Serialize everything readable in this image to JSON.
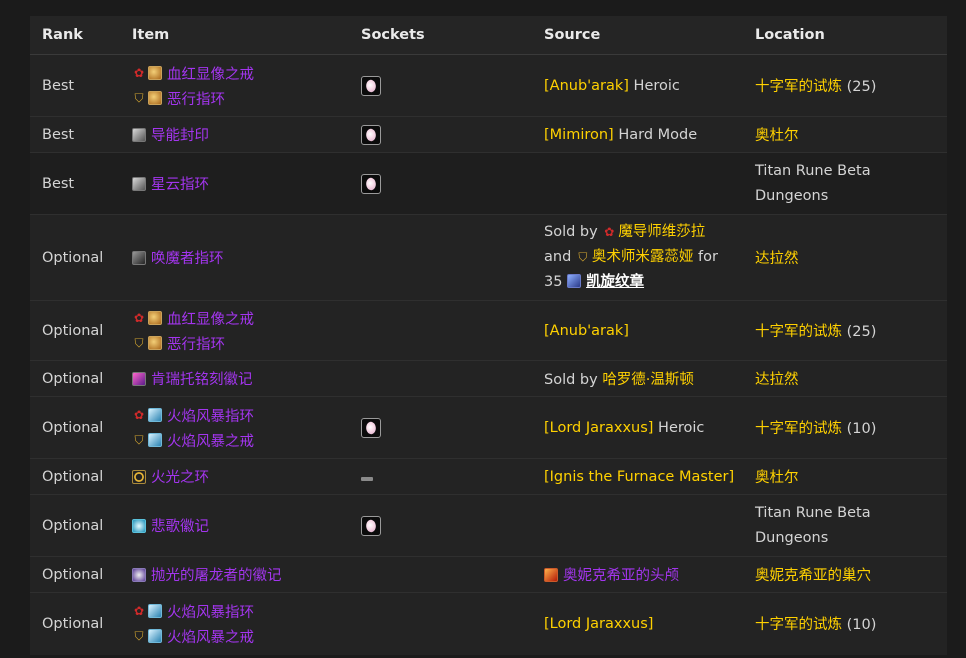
{
  "headers": [
    "Rank",
    "Item",
    "Sockets",
    "Source",
    "Location"
  ],
  "rows": [
    {
      "rank": "Best",
      "items": [
        {
          "faction": "horde",
          "icon": "gold-face",
          "name": "血红显像之戒"
        },
        {
          "faction": "alliance",
          "icon": "gold-face",
          "name": "恶行指环"
        }
      ],
      "socket": "gem",
      "source": {
        "bracket": "[Anub'arak]",
        "suffix": " Heroic"
      },
      "location": {
        "name": "十字军的试炼",
        "suffix": " (25)"
      }
    },
    {
      "rank": "Best",
      "items": [
        {
          "faction": "",
          "icon": "gray",
          "name": "导能封印"
        }
      ],
      "socket": "gem",
      "source": {
        "bracket": "[Mimiron]",
        "suffix": " Hard Mode"
      },
      "location": {
        "name": "奥杜尔",
        "suffix": ""
      }
    },
    {
      "rank": "Best",
      "items": [
        {
          "faction": "",
          "icon": "gray",
          "name": "星云指环"
        }
      ],
      "socket": "gem",
      "source": {
        "bracket": "",
        "suffix": ""
      },
      "location": {
        "name": "",
        "suffix": "",
        "plain_lines": [
          "Titan Rune Beta",
          "Dungeons"
        ]
      }
    },
    {
      "rank": "Optional",
      "items": [
        {
          "faction": "",
          "icon": "dark",
          "name": "唤魔者指环"
        }
      ],
      "socket": "",
      "source": {
        "sold_by": "Sold by",
        "vendor_horde": "魔导师维莎拉",
        "and": "and",
        "vendor_alliance": "奥术师米露蕊娅",
        "for": "for",
        "price": "35",
        "currency": "凯旋纹章"
      },
      "location": {
        "name": "达拉然",
        "suffix": ""
      }
    },
    {
      "rank": "Optional",
      "items": [
        {
          "faction": "horde",
          "icon": "gold-face",
          "name": "血红显像之戒"
        },
        {
          "faction": "alliance",
          "icon": "gold-face",
          "name": "恶行指环"
        }
      ],
      "socket": "",
      "source": {
        "bracket": "[Anub'arak]",
        "suffix": ""
      },
      "location": {
        "name": "十字军的试炼",
        "suffix": " (25)"
      }
    },
    {
      "rank": "Optional",
      "items": [
        {
          "faction": "",
          "icon": "purple",
          "name": "肯瑞托铭刻徽记"
        }
      ],
      "socket": "",
      "source": {
        "sold_by": "Sold by",
        "vendor": "哈罗德·温斯顿"
      },
      "location": {
        "name": "达拉然",
        "suffix": ""
      }
    },
    {
      "rank": "Optional",
      "items": [
        {
          "faction": "horde",
          "icon": "blue",
          "name": "火焰风暴指环"
        },
        {
          "faction": "alliance",
          "icon": "blue",
          "name": "火焰风暴之戒"
        }
      ],
      "socket": "gem",
      "source": {
        "bracket": "[Lord Jaraxxus]",
        "suffix": " Heroic"
      },
      "location": {
        "name": "十字军的试炼",
        "suffix": " (10)"
      }
    },
    {
      "rank": "Optional",
      "items": [
        {
          "faction": "",
          "icon": "ring",
          "name": "火光之环"
        }
      ],
      "socket": "dash",
      "source": {
        "bracket": "[Ignis the Furnace Master]",
        "suffix": ""
      },
      "location": {
        "name": "奥杜尔",
        "suffix": ""
      }
    },
    {
      "rank": "Optional",
      "items": [
        {
          "faction": "",
          "icon": "cyan",
          "name": "悲歌徽记"
        }
      ],
      "socket": "gem",
      "source": {
        "bracket": "",
        "suffix": ""
      },
      "location": {
        "name": "",
        "suffix": "",
        "plain_lines": [
          "Titan Rune Beta",
          "Dungeons"
        ]
      }
    },
    {
      "rank": "Optional",
      "items": [
        {
          "faction": "",
          "icon": "violet",
          "name": "抛光的屠龙者的徽记"
        }
      ],
      "socket": "",
      "source": {
        "drop_item": "奥妮克希亚的头颅"
      },
      "location": {
        "name": "奥妮克希亚的巢穴",
        "suffix": ""
      }
    },
    {
      "rank": "Optional",
      "items": [
        {
          "faction": "horde",
          "icon": "blue",
          "name": "火焰风暴指环"
        },
        {
          "faction": "alliance",
          "icon": "blue",
          "name": "火焰风暴之戒"
        }
      ],
      "socket": "",
      "source": {
        "bracket": "[Lord Jaraxxus]",
        "suffix": ""
      },
      "location": {
        "name": "十字军的试炼",
        "suffix": " (10)"
      }
    }
  ],
  "colors": {
    "epic": "#a335ee",
    "gold": "#ffd100",
    "horde": "#d12a2a",
    "alliance": "#d3a630"
  }
}
